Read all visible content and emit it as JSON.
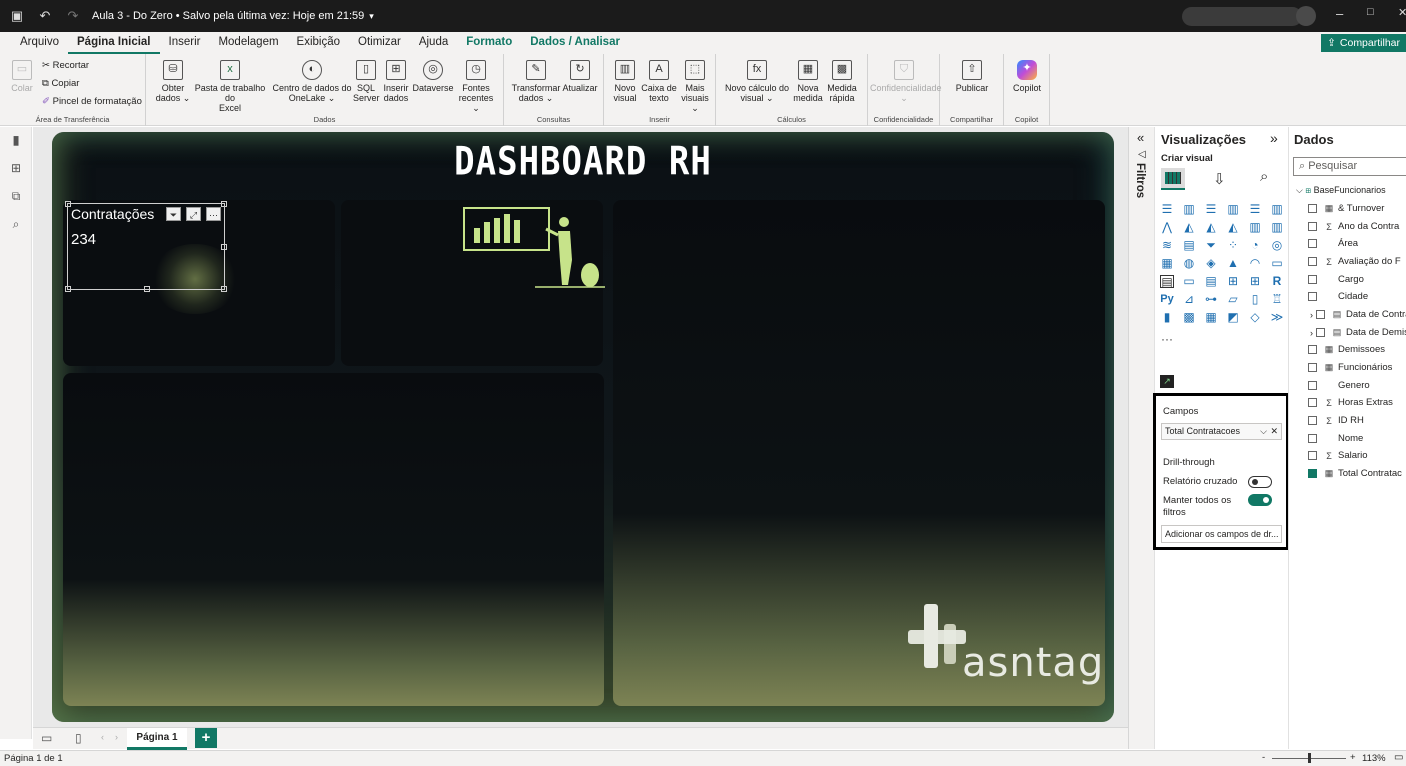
{
  "titlebar": {
    "doc_title": "Aula 3 - Do Zero • Salvo pela última vez: Hoje em 21:59",
    "title_dropdown": "▾",
    "minimize": "–",
    "maximize": "□",
    "close": "✕"
  },
  "menu": {
    "tabs": [
      "Arquivo",
      "Página Inicial",
      "Inserir",
      "Modelagem",
      "Exibição",
      "Otimizar",
      "Ajuda",
      "Formato",
      "Dados / Analisar"
    ],
    "share": "Compartilhar"
  },
  "ribbon": {
    "clipboard": {
      "paste": "Colar",
      "cut": "Recortar",
      "copy": "Copiar",
      "format_painter": "Pincel de formatação",
      "group": "Área de Transferência"
    },
    "data": {
      "get_data": [
        "Obter",
        "dados ⌄"
      ],
      "excel": [
        "Pasta de trabalho do",
        "Excel"
      ],
      "onelake": [
        "Centro de dados do",
        "OneLake ⌄"
      ],
      "sql": [
        "SQL",
        "Server"
      ],
      "enter": [
        "Inserir",
        "dados"
      ],
      "dataverse": [
        "Dataverse",
        ""
      ],
      "recent": [
        "Fontes",
        "recentes ⌄"
      ],
      "group": "Dados"
    },
    "queries": {
      "transform": [
        "Transformar",
        "dados ⌄"
      ],
      "refresh": [
        "Atualizar",
        ""
      ],
      "group": "Consultas"
    },
    "insert": {
      "new_visual": [
        "Novo",
        "visual"
      ],
      "text_box": [
        "Caixa de",
        "texto"
      ],
      "more_visuals": [
        "Mais",
        "visuais ⌄"
      ],
      "group": "Inserir"
    },
    "calc": {
      "new_calc": [
        "Novo cálculo do",
        "visual ⌄"
      ],
      "new_measure": [
        "Nova",
        "medida"
      ],
      "quick_measure": [
        "Medida",
        "rápida"
      ],
      "group": "Cálculos"
    },
    "sensitivity": {
      "label": "Confidencialidade",
      "arrow": "⌄",
      "group": "Confidencialidade"
    },
    "share": {
      "publish": "Publicar",
      "group": "Compartilhar"
    },
    "copilot": {
      "label": "Copilot",
      "group": "Copilot"
    }
  },
  "report": {
    "title": "DASHBOARD RH",
    "card": {
      "title": "Contratações",
      "value": "234"
    },
    "logo_text": "asntag"
  },
  "pages": {
    "tab": "Página 1",
    "add": "+"
  },
  "status": {
    "page": "Página 1 de 1",
    "zoom": "113%",
    "zoom_minus": "-",
    "zoom_plus": "+"
  },
  "filters": {
    "label": "Filtros"
  },
  "viz": {
    "title": "Visualizações",
    "create": "Criar visual",
    "more": "···",
    "fields_label": "Campos",
    "field_value": "Total Contratacoes",
    "drill": "Drill-through",
    "cross_report": "Relatório cruzado",
    "keep_filters": "Manter todos os filtros",
    "add_drill": "Adicionar os campos de dr..."
  },
  "data_pane": {
    "title": "Dados",
    "search_placeholder": "Pesquisar",
    "table": "BaseFuncionarios",
    "fields": [
      {
        "name": "& Turnover",
        "icon": "▦",
        "checked": false,
        "expand": false
      },
      {
        "name": "Ano da Contra",
        "icon": "Σ",
        "checked": false,
        "expand": false
      },
      {
        "name": "Área",
        "icon": "",
        "checked": false,
        "expand": false
      },
      {
        "name": "Avaliação do F",
        "icon": "Σ",
        "checked": false,
        "expand": false
      },
      {
        "name": "Cargo",
        "icon": "",
        "checked": false,
        "expand": false
      },
      {
        "name": "Cidade",
        "icon": "",
        "checked": false,
        "expand": false
      },
      {
        "name": "Data de Contra",
        "icon": "▤",
        "checked": false,
        "expand": true
      },
      {
        "name": "Data de Demis",
        "icon": "▤",
        "checked": false,
        "expand": true
      },
      {
        "name": "Demissoes",
        "icon": "▦",
        "checked": false,
        "expand": false
      },
      {
        "name": "Funcionários",
        "icon": "▦",
        "checked": false,
        "expand": false
      },
      {
        "name": "Genero",
        "icon": "",
        "checked": false,
        "expand": false
      },
      {
        "name": "Horas Extras",
        "icon": "Σ",
        "checked": false,
        "expand": false
      },
      {
        "name": "ID RH",
        "icon": "Σ",
        "checked": false,
        "expand": false
      },
      {
        "name": "Nome",
        "icon": "",
        "checked": false,
        "expand": false
      },
      {
        "name": "Salario",
        "icon": "Σ",
        "checked": false,
        "expand": false
      },
      {
        "name": "Total Contratac",
        "icon": "▦",
        "checked": true,
        "expand": false
      }
    ]
  },
  "colors": {
    "accent": "#117865",
    "canvas_dark": "#0a0d10",
    "olive": "#7d8354"
  }
}
